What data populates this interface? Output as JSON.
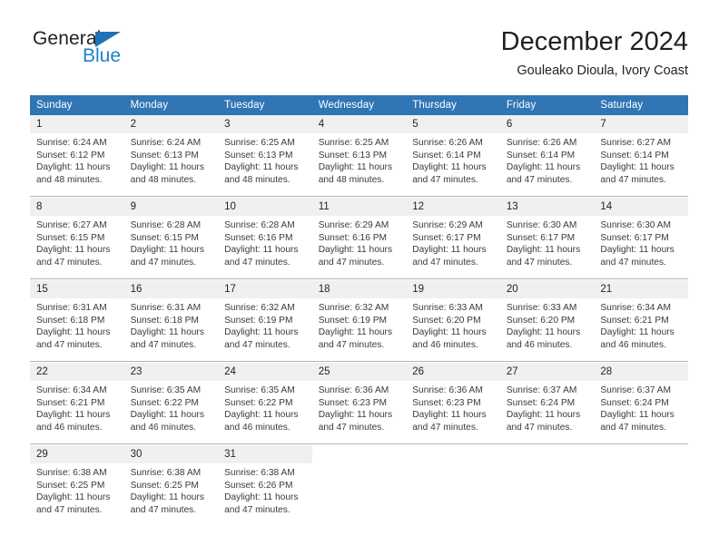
{
  "brand": {
    "name_top": "General",
    "name_bottom": "Blue",
    "triangle_icon": "triangle-logo-icon",
    "color_dark": "#231f20",
    "color_blue": "#1f82c8"
  },
  "header": {
    "title": "December 2024",
    "subtitle": "Gouleako Dioula, Ivory Coast"
  },
  "theme": {
    "header_row_bg": "#3075b4",
    "header_row_text": "#ffffff",
    "daynum_bg": "#f0f0f0",
    "week_separator": "#9fb9cf",
    "body_text": "#3a3a3a"
  },
  "calendar": {
    "weekday_headers": [
      "Sunday",
      "Monday",
      "Tuesday",
      "Wednesday",
      "Thursday",
      "Friday",
      "Saturday"
    ],
    "weeks": [
      [
        {
          "day": "1",
          "sunrise": "Sunrise: 6:24 AM",
          "sunset": "Sunset: 6:12 PM",
          "daylight_1": "Daylight: 11 hours",
          "daylight_2": "and 48 minutes."
        },
        {
          "day": "2",
          "sunrise": "Sunrise: 6:24 AM",
          "sunset": "Sunset: 6:13 PM",
          "daylight_1": "Daylight: 11 hours",
          "daylight_2": "and 48 minutes."
        },
        {
          "day": "3",
          "sunrise": "Sunrise: 6:25 AM",
          "sunset": "Sunset: 6:13 PM",
          "daylight_1": "Daylight: 11 hours",
          "daylight_2": "and 48 minutes."
        },
        {
          "day": "4",
          "sunrise": "Sunrise: 6:25 AM",
          "sunset": "Sunset: 6:13 PM",
          "daylight_1": "Daylight: 11 hours",
          "daylight_2": "and 48 minutes."
        },
        {
          "day": "5",
          "sunrise": "Sunrise: 6:26 AM",
          "sunset": "Sunset: 6:14 PM",
          "daylight_1": "Daylight: 11 hours",
          "daylight_2": "and 47 minutes."
        },
        {
          "day": "6",
          "sunrise": "Sunrise: 6:26 AM",
          "sunset": "Sunset: 6:14 PM",
          "daylight_1": "Daylight: 11 hours",
          "daylight_2": "and 47 minutes."
        },
        {
          "day": "7",
          "sunrise": "Sunrise: 6:27 AM",
          "sunset": "Sunset: 6:14 PM",
          "daylight_1": "Daylight: 11 hours",
          "daylight_2": "and 47 minutes."
        }
      ],
      [
        {
          "day": "8",
          "sunrise": "Sunrise: 6:27 AM",
          "sunset": "Sunset: 6:15 PM",
          "daylight_1": "Daylight: 11 hours",
          "daylight_2": "and 47 minutes."
        },
        {
          "day": "9",
          "sunrise": "Sunrise: 6:28 AM",
          "sunset": "Sunset: 6:15 PM",
          "daylight_1": "Daylight: 11 hours",
          "daylight_2": "and 47 minutes."
        },
        {
          "day": "10",
          "sunrise": "Sunrise: 6:28 AM",
          "sunset": "Sunset: 6:16 PM",
          "daylight_1": "Daylight: 11 hours",
          "daylight_2": "and 47 minutes."
        },
        {
          "day": "11",
          "sunrise": "Sunrise: 6:29 AM",
          "sunset": "Sunset: 6:16 PM",
          "daylight_1": "Daylight: 11 hours",
          "daylight_2": "and 47 minutes."
        },
        {
          "day": "12",
          "sunrise": "Sunrise: 6:29 AM",
          "sunset": "Sunset: 6:17 PM",
          "daylight_1": "Daylight: 11 hours",
          "daylight_2": "and 47 minutes."
        },
        {
          "day": "13",
          "sunrise": "Sunrise: 6:30 AM",
          "sunset": "Sunset: 6:17 PM",
          "daylight_1": "Daylight: 11 hours",
          "daylight_2": "and 47 minutes."
        },
        {
          "day": "14",
          "sunrise": "Sunrise: 6:30 AM",
          "sunset": "Sunset: 6:17 PM",
          "daylight_1": "Daylight: 11 hours",
          "daylight_2": "and 47 minutes."
        }
      ],
      [
        {
          "day": "15",
          "sunrise": "Sunrise: 6:31 AM",
          "sunset": "Sunset: 6:18 PM",
          "daylight_1": "Daylight: 11 hours",
          "daylight_2": "and 47 minutes."
        },
        {
          "day": "16",
          "sunrise": "Sunrise: 6:31 AM",
          "sunset": "Sunset: 6:18 PM",
          "daylight_1": "Daylight: 11 hours",
          "daylight_2": "and 47 minutes."
        },
        {
          "day": "17",
          "sunrise": "Sunrise: 6:32 AM",
          "sunset": "Sunset: 6:19 PM",
          "daylight_1": "Daylight: 11 hours",
          "daylight_2": "and 47 minutes."
        },
        {
          "day": "18",
          "sunrise": "Sunrise: 6:32 AM",
          "sunset": "Sunset: 6:19 PM",
          "daylight_1": "Daylight: 11 hours",
          "daylight_2": "and 47 minutes."
        },
        {
          "day": "19",
          "sunrise": "Sunrise: 6:33 AM",
          "sunset": "Sunset: 6:20 PM",
          "daylight_1": "Daylight: 11 hours",
          "daylight_2": "and 46 minutes."
        },
        {
          "day": "20",
          "sunrise": "Sunrise: 6:33 AM",
          "sunset": "Sunset: 6:20 PM",
          "daylight_1": "Daylight: 11 hours",
          "daylight_2": "and 46 minutes."
        },
        {
          "day": "21",
          "sunrise": "Sunrise: 6:34 AM",
          "sunset": "Sunset: 6:21 PM",
          "daylight_1": "Daylight: 11 hours",
          "daylight_2": "and 46 minutes."
        }
      ],
      [
        {
          "day": "22",
          "sunrise": "Sunrise: 6:34 AM",
          "sunset": "Sunset: 6:21 PM",
          "daylight_1": "Daylight: 11 hours",
          "daylight_2": "and 46 minutes."
        },
        {
          "day": "23",
          "sunrise": "Sunrise: 6:35 AM",
          "sunset": "Sunset: 6:22 PM",
          "daylight_1": "Daylight: 11 hours",
          "daylight_2": "and 46 minutes."
        },
        {
          "day": "24",
          "sunrise": "Sunrise: 6:35 AM",
          "sunset": "Sunset: 6:22 PM",
          "daylight_1": "Daylight: 11 hours",
          "daylight_2": "and 46 minutes."
        },
        {
          "day": "25",
          "sunrise": "Sunrise: 6:36 AM",
          "sunset": "Sunset: 6:23 PM",
          "daylight_1": "Daylight: 11 hours",
          "daylight_2": "and 47 minutes."
        },
        {
          "day": "26",
          "sunrise": "Sunrise: 6:36 AM",
          "sunset": "Sunset: 6:23 PM",
          "daylight_1": "Daylight: 11 hours",
          "daylight_2": "and 47 minutes."
        },
        {
          "day": "27",
          "sunrise": "Sunrise: 6:37 AM",
          "sunset": "Sunset: 6:24 PM",
          "daylight_1": "Daylight: 11 hours",
          "daylight_2": "and 47 minutes."
        },
        {
          "day": "28",
          "sunrise": "Sunrise: 6:37 AM",
          "sunset": "Sunset: 6:24 PM",
          "daylight_1": "Daylight: 11 hours",
          "daylight_2": "and 47 minutes."
        }
      ],
      [
        {
          "day": "29",
          "sunrise": "Sunrise: 6:38 AM",
          "sunset": "Sunset: 6:25 PM",
          "daylight_1": "Daylight: 11 hours",
          "daylight_2": "and 47 minutes."
        },
        {
          "day": "30",
          "sunrise": "Sunrise: 6:38 AM",
          "sunset": "Sunset: 6:25 PM",
          "daylight_1": "Daylight: 11 hours",
          "daylight_2": "and 47 minutes."
        },
        {
          "day": "31",
          "sunrise": "Sunrise: 6:38 AM",
          "sunset": "Sunset: 6:26 PM",
          "daylight_1": "Daylight: 11 hours",
          "daylight_2": "and 47 minutes."
        },
        {
          "day": "",
          "sunrise": "",
          "sunset": "",
          "daylight_1": "",
          "daylight_2": ""
        },
        {
          "day": "",
          "sunrise": "",
          "sunset": "",
          "daylight_1": "",
          "daylight_2": ""
        },
        {
          "day": "",
          "sunrise": "",
          "sunset": "",
          "daylight_1": "",
          "daylight_2": ""
        },
        {
          "day": "",
          "sunrise": "",
          "sunset": "",
          "daylight_1": "",
          "daylight_2": ""
        }
      ]
    ]
  }
}
